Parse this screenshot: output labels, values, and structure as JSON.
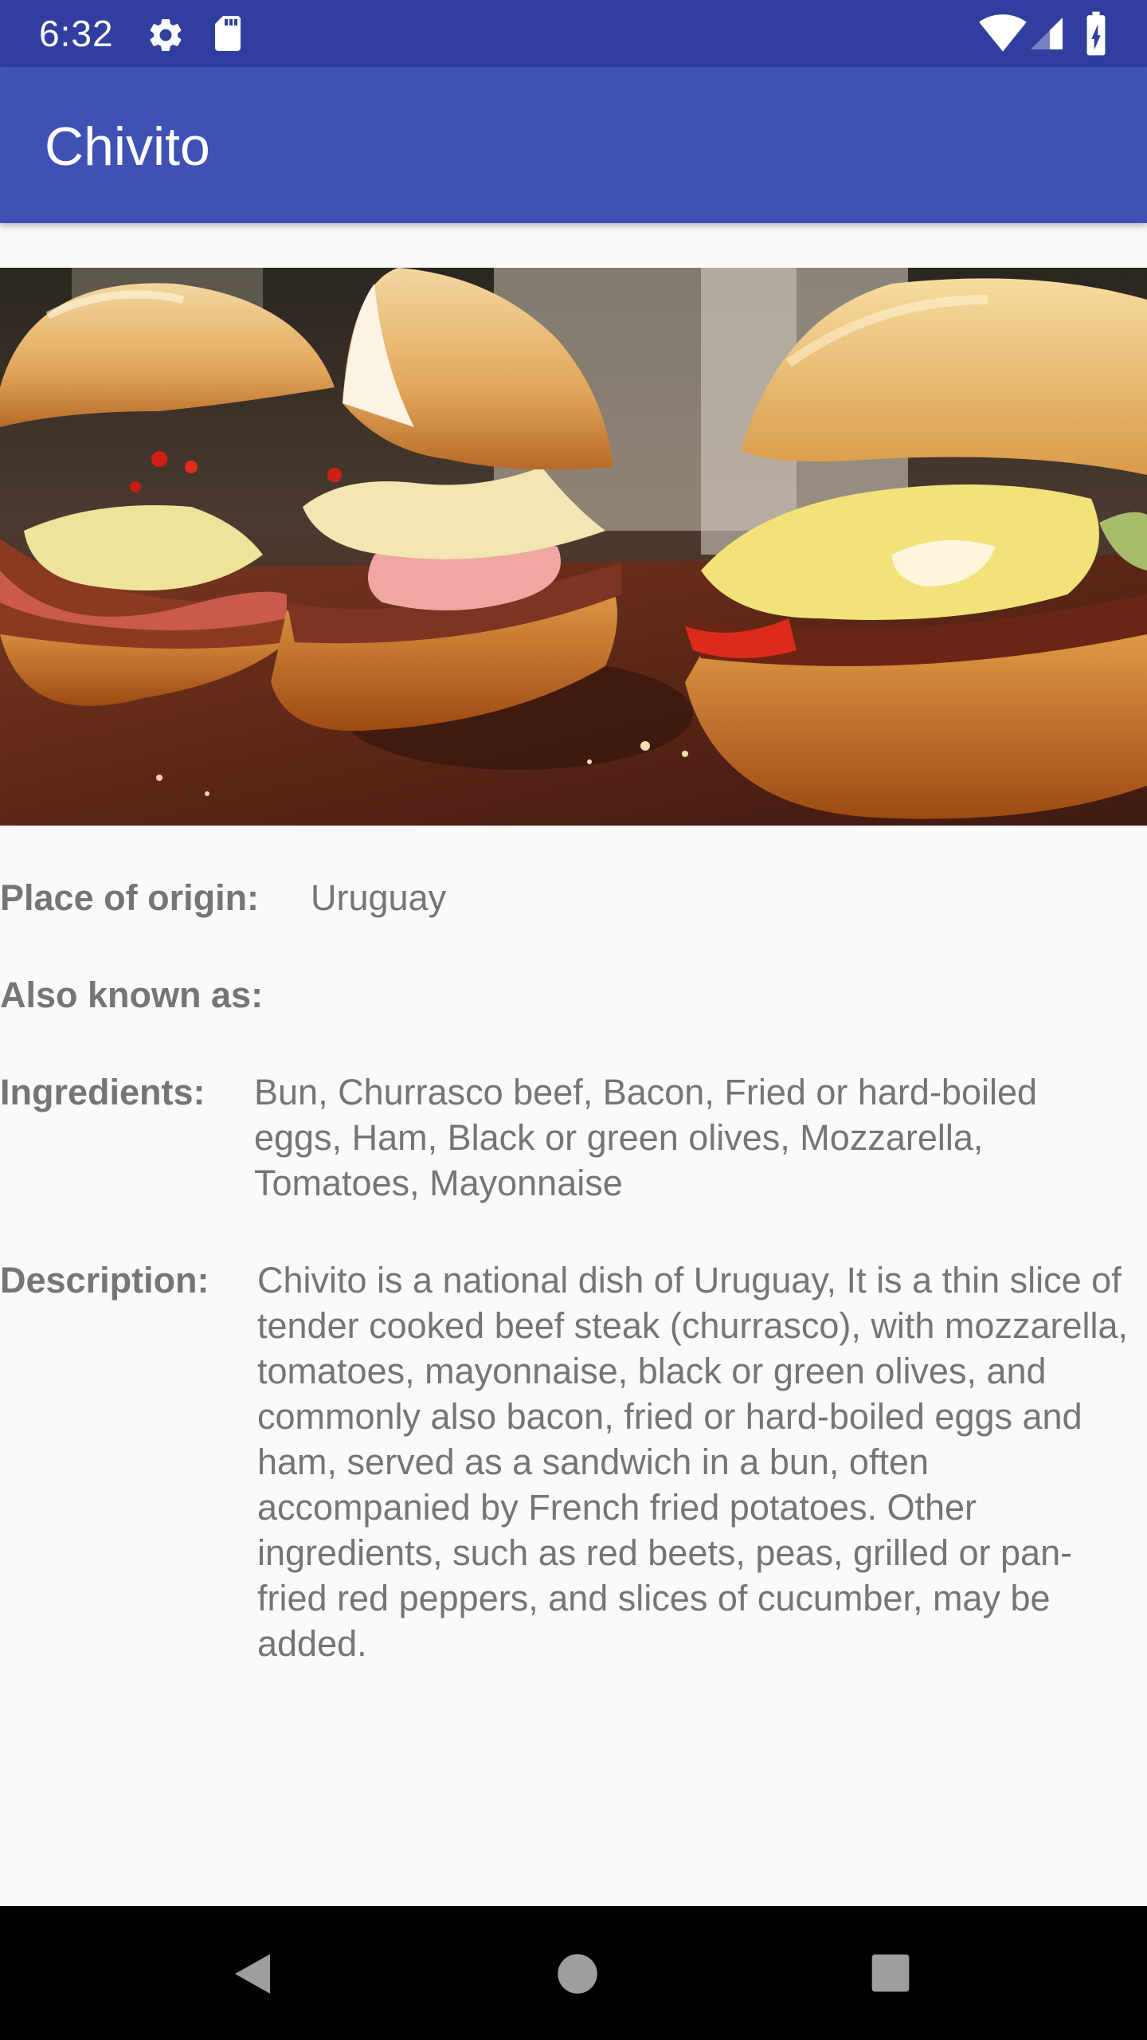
{
  "status_bar": {
    "time": "6:32",
    "icons": [
      "gear-icon",
      "sd-card-icon",
      "wifi-icon",
      "cell-signal-icon",
      "battery-charging-icon"
    ]
  },
  "app_bar": {
    "title": "Chivito"
  },
  "hero_image": {
    "alt": "sandwich-photo"
  },
  "details": {
    "origin_label": "Place of origin:",
    "origin_value": "Uruguay",
    "known_as_label": "Also known as:",
    "known_as_value": "",
    "ingredients_label": "Ingredients:",
    "ingredients_value": "Bun, Churrasco beef, Bacon, Fried or hard-boiled eggs, Ham, Black or green olives, Mozzarella, Tomatoes, Mayonnaise",
    "description_label": "Description:",
    "description_value": "Chivito is a national dish of Uruguay, It is a thin slice of tender cooked beef steak (churrasco), with mozzarella, tomatoes, mayonnaise, black or green olives, and commonly also bacon, fried or hard-boiled eggs and ham, served as a sandwich in a bun, often accompanied by French fried potatoes. Other ingredients, such as red beets, peas, grilled or pan-fried red peppers, and slices of cucumber, may be added."
  },
  "nav_bar": {
    "icons": [
      "back-icon",
      "home-icon",
      "recents-icon"
    ]
  },
  "colors": {
    "status_bar": "#303f9f",
    "app_bar": "#3f51b5",
    "background": "#fafafa",
    "text": "#757575",
    "nav_bar": "#000000"
  }
}
